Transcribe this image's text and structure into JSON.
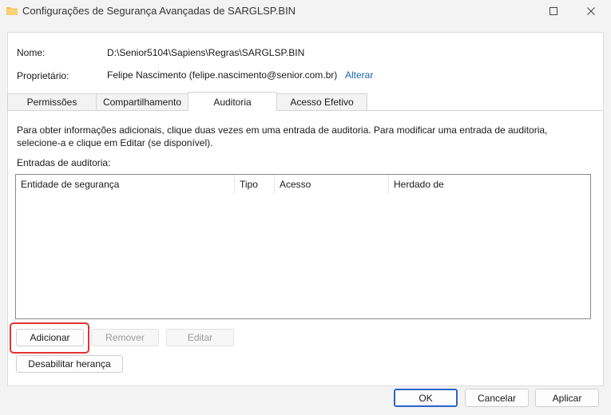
{
  "window": {
    "title": "Configurações de Segurança Avançadas de SARGLSP.BIN"
  },
  "fields": {
    "name_label": "Nome:",
    "name_value": "D:\\Senior5104\\Sapiens\\Regras\\SARGLSP.BIN",
    "owner_label": "Proprietário:",
    "owner_value": "Felipe Nascimento (felipe.nascimento@senior.com.br)",
    "change_link": "Alterar"
  },
  "tabs": [
    {
      "label": "Permissões",
      "active": false
    },
    {
      "label": "Compartilhamento",
      "active": false
    },
    {
      "label": "Auditoria",
      "active": true
    },
    {
      "label": "Acesso Efetivo",
      "active": false
    }
  ],
  "info_text": "Para obter informações adicionais, clique duas vezes em uma entrada de auditoria. Para modificar uma entrada de auditoria, selecione-a e clique em Editar (se disponível).",
  "entries": {
    "label": "Entradas de auditoria:",
    "columns": [
      "Entidade de segurança",
      "Tipo",
      "Acesso",
      "Herdado de"
    ],
    "rows": []
  },
  "buttons": {
    "add": "Adicionar",
    "remove": "Remover",
    "edit": "Editar",
    "disable_inheritance": "Desabilitar herança",
    "ok": "OK",
    "cancel": "Cancelar",
    "apply": "Aplicar"
  },
  "colors": {
    "link": "#1a64b4",
    "highlight": "#e03434",
    "default_button_border": "#2b63c7",
    "folder": "#f0c25c"
  }
}
